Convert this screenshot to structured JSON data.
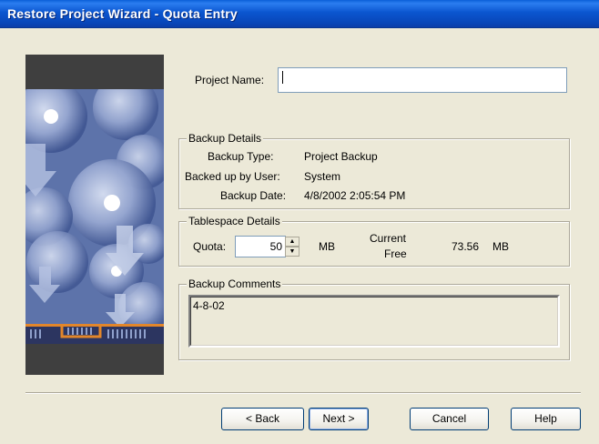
{
  "window": {
    "title": "Restore Project Wizard - Quota Entry"
  },
  "project": {
    "label": "Project Name:",
    "value": ""
  },
  "backup_details": {
    "title": "Backup Details",
    "type_label": "Backup Type:",
    "type_value": "Project Backup",
    "user_label": "Backed up by User:",
    "user_value": "System",
    "date_label": "Backup Date:",
    "date_value": "4/8/2002 2:05:54 PM"
  },
  "tablespace": {
    "title": "Tablespace Details",
    "quota_label": "Quota:",
    "quota_value": "50",
    "quota_unit": "MB",
    "current_label_1": "Current",
    "current_label_2": "Free",
    "free_value": "73.56",
    "free_unit": "MB"
  },
  "comments": {
    "title": "Backup Comments",
    "value": "4-8-02"
  },
  "buttons": {
    "back": "< Back",
    "next": "Next >",
    "cancel": "Cancel",
    "help": "Help"
  },
  "icons": {
    "spin_up": "spin-up-icon",
    "spin_down": "spin-down-icon"
  },
  "colors": {
    "titlebar": "#0a56d0",
    "dialog_bg": "#ece9d8",
    "art_frame": "#3f3f3f",
    "art_accent": "#e2862a"
  }
}
